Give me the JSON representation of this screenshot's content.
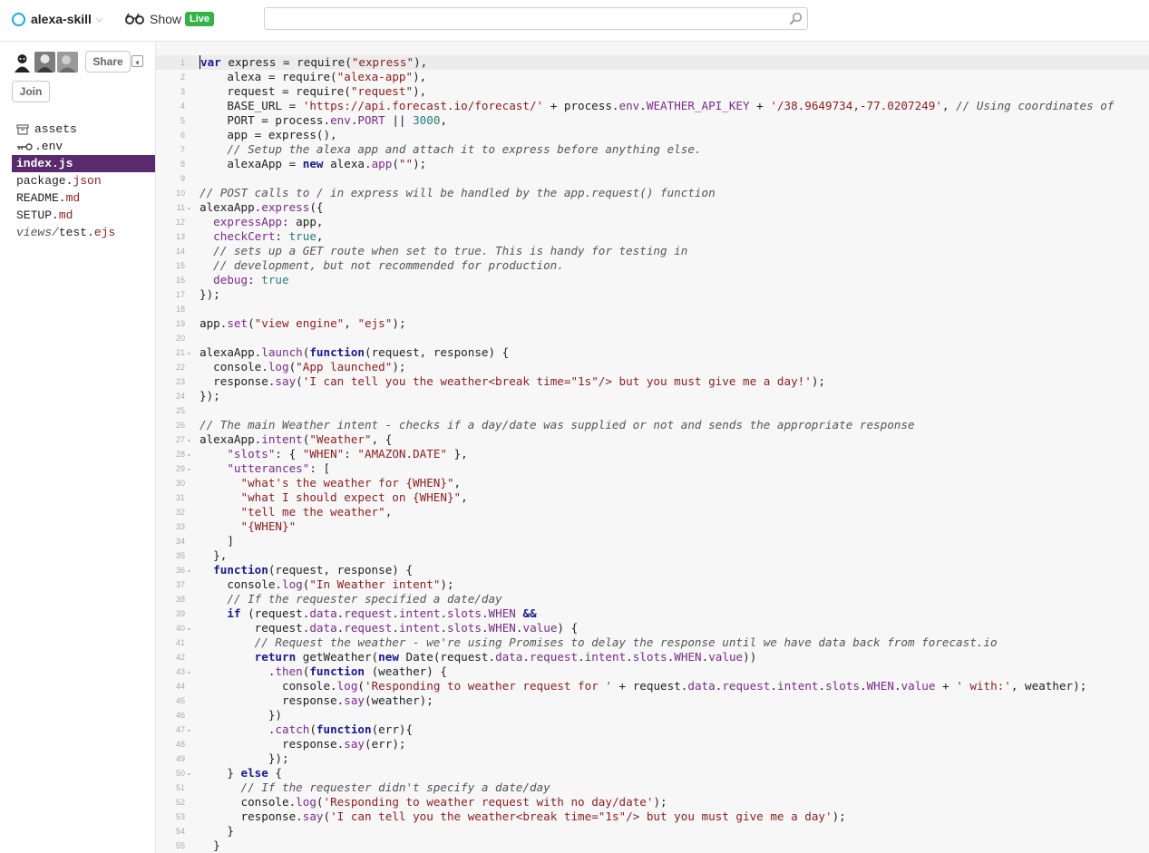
{
  "header": {
    "project_name": "alexa-skill",
    "show_label": "Show",
    "live_badge": "Live",
    "search_value": ""
  },
  "sidebar": {
    "share_label": "Share",
    "join_label": "Join",
    "files": [
      {
        "name": "assets",
        "ext": "",
        "icon": "archive-icon"
      },
      {
        "name": ".env",
        "ext": "",
        "icon": "key-icon"
      },
      {
        "name": "index.js",
        "ext": "",
        "icon": ""
      },
      {
        "name": "package.",
        "ext": "json",
        "icon": ""
      },
      {
        "name": "README.",
        "ext": "md",
        "icon": ""
      },
      {
        "name": "SETUP.",
        "ext": "md",
        "icon": ""
      },
      {
        "folder": "views/",
        "name": "test.",
        "ext": "ejs",
        "icon": ""
      }
    ]
  },
  "editor": {
    "active_file": "index.js",
    "current_line": 1,
    "lines": [
      [
        [
          "k",
          "var"
        ],
        [
          "t",
          " express = require("
        ],
        [
          "s",
          "\"express\""
        ],
        [
          "t",
          "),"
        ]
      ],
      [
        [
          "t",
          "    alexa = require("
        ],
        [
          "s",
          "\"alexa-app\""
        ],
        [
          "t",
          "),"
        ]
      ],
      [
        [
          "t",
          "    request = require("
        ],
        [
          "s",
          "\"request\""
        ],
        [
          "t",
          "),"
        ]
      ],
      [
        [
          "t",
          "    BASE_URL = "
        ],
        [
          "s",
          "'https://api.forecast.io/forecast/'"
        ],
        [
          "t",
          " + process."
        ],
        [
          "p",
          "env"
        ],
        [
          "t",
          "."
        ],
        [
          "p",
          "WEATHER_API_KEY"
        ],
        [
          "t",
          " + "
        ],
        [
          "s",
          "'/38.9649734,-77.0207249'"
        ],
        [
          "t",
          ", "
        ],
        [
          "c",
          "// Using coordinates of"
        ]
      ],
      [
        [
          "t",
          "    PORT = process."
        ],
        [
          "p",
          "env"
        ],
        [
          "t",
          "."
        ],
        [
          "p",
          "PORT"
        ],
        [
          "t",
          " || "
        ],
        [
          "n",
          "3000"
        ],
        [
          "t",
          ","
        ]
      ],
      [
        [
          "t",
          "    app = express(),"
        ]
      ],
      [
        [
          "c",
          "    // Setup the alexa app and attach it to express before anything else."
        ]
      ],
      [
        [
          "t",
          "    alexaApp = "
        ],
        [
          "k",
          "new"
        ],
        [
          "t",
          " alexa."
        ],
        [
          "p",
          "app"
        ],
        [
          "t",
          "("
        ],
        [
          "s",
          "\"\""
        ],
        [
          "t",
          ");"
        ]
      ],
      [],
      [
        [
          "c",
          "// POST calls to / in express will be handled by the app.request() function"
        ]
      ],
      [
        [
          "t",
          "alexaApp."
        ],
        [
          "p",
          "express"
        ],
        [
          "t",
          "({"
        ]
      ],
      [
        [
          "p",
          "  expressApp"
        ],
        [
          "t",
          ": app,"
        ]
      ],
      [
        [
          "p",
          "  checkCert"
        ],
        [
          "t",
          ": "
        ],
        [
          "n",
          "true"
        ],
        [
          "t",
          ","
        ]
      ],
      [
        [
          "c",
          "  // sets up a GET route when set to true. This is handy for testing in"
        ]
      ],
      [
        [
          "c",
          "  // development, but not recommended for production."
        ]
      ],
      [
        [
          "p",
          "  debug"
        ],
        [
          "t",
          ": "
        ],
        [
          "n",
          "true"
        ]
      ],
      [
        [
          "t",
          "});"
        ]
      ],
      [],
      [
        [
          "t",
          "app."
        ],
        [
          "p",
          "set"
        ],
        [
          "t",
          "("
        ],
        [
          "s",
          "\"view engine\""
        ],
        [
          "t",
          ", "
        ],
        [
          "s",
          "\"ejs\""
        ],
        [
          "t",
          ");"
        ]
      ],
      [],
      [
        [
          "t",
          "alexaApp."
        ],
        [
          "p",
          "launch"
        ],
        [
          "t",
          "("
        ],
        [
          "k",
          "function"
        ],
        [
          "t",
          "(request, response) {"
        ]
      ],
      [
        [
          "t",
          "  console."
        ],
        [
          "p",
          "log"
        ],
        [
          "t",
          "("
        ],
        [
          "s",
          "\"App launched\""
        ],
        [
          "t",
          ");"
        ]
      ],
      [
        [
          "t",
          "  response."
        ],
        [
          "p",
          "say"
        ],
        [
          "t",
          "("
        ],
        [
          "s",
          "'I can tell you the weather<break time=\"1s\"/> but you must give me a day!'"
        ],
        [
          "t",
          ");"
        ]
      ],
      [
        [
          "t",
          "});"
        ]
      ],
      [],
      [
        [
          "c",
          "// The main Weather intent - checks if a day/date was supplied or not and sends the appropriate response"
        ]
      ],
      [
        [
          "t",
          "alexaApp."
        ],
        [
          "p",
          "intent"
        ],
        [
          "t",
          "("
        ],
        [
          "s",
          "\"Weather\""
        ],
        [
          "t",
          ", {"
        ]
      ],
      [
        [
          "p",
          "    \"slots\""
        ],
        [
          "t",
          ": { "
        ],
        [
          "s",
          "\"WHEN\""
        ],
        [
          "t",
          ": "
        ],
        [
          "s",
          "\"AMAZON.DATE\""
        ],
        [
          "t",
          " },"
        ]
      ],
      [
        [
          "p",
          "    \"utterances\""
        ],
        [
          "t",
          ": ["
        ]
      ],
      [
        [
          "s",
          "      \"what's the weather for {WHEN}\""
        ],
        [
          "t",
          ","
        ]
      ],
      [
        [
          "s",
          "      \"what I should expect on {WHEN}\""
        ],
        [
          "t",
          ","
        ]
      ],
      [
        [
          "s",
          "      \"tell me the weather\""
        ],
        [
          "t",
          ","
        ]
      ],
      [
        [
          "s",
          "      \"{WHEN}\""
        ]
      ],
      [
        [
          "t",
          "    ]"
        ]
      ],
      [
        [
          "t",
          "  },"
        ]
      ],
      [
        [
          "k",
          "  function"
        ],
        [
          "t",
          "(request, response) {"
        ]
      ],
      [
        [
          "t",
          "    console."
        ],
        [
          "p",
          "log"
        ],
        [
          "t",
          "("
        ],
        [
          "s",
          "\"In Weather intent\""
        ],
        [
          "t",
          ");"
        ]
      ],
      [
        [
          "c",
          "    // If the requester specified a date/day"
        ]
      ],
      [
        [
          "k",
          "    if"
        ],
        [
          "t",
          " (request."
        ],
        [
          "p",
          "data"
        ],
        [
          "t",
          "."
        ],
        [
          "p",
          "request"
        ],
        [
          "t",
          "."
        ],
        [
          "p",
          "intent"
        ],
        [
          "t",
          "."
        ],
        [
          "p",
          "slots"
        ],
        [
          "t",
          "."
        ],
        [
          "p",
          "WHEN"
        ],
        [
          "t",
          " "
        ],
        [
          "k",
          "&&"
        ]
      ],
      [
        [
          "t",
          "        request."
        ],
        [
          "p",
          "data"
        ],
        [
          "t",
          "."
        ],
        [
          "p",
          "request"
        ],
        [
          "t",
          "."
        ],
        [
          "p",
          "intent"
        ],
        [
          "t",
          "."
        ],
        [
          "p",
          "slots"
        ],
        [
          "t",
          "."
        ],
        [
          "p",
          "WHEN"
        ],
        [
          "t",
          "."
        ],
        [
          "p",
          "value"
        ],
        [
          "t",
          ") {"
        ]
      ],
      [
        [
          "c",
          "        // Request the weather - we're using Promises to delay the response until we have data back from forecast.io"
        ]
      ],
      [
        [
          "k",
          "        return"
        ],
        [
          "t",
          " getWeather("
        ],
        [
          "k",
          "new"
        ],
        [
          "t",
          " Date(request."
        ],
        [
          "p",
          "data"
        ],
        [
          "t",
          "."
        ],
        [
          "p",
          "request"
        ],
        [
          "t",
          "."
        ],
        [
          "p",
          "intent"
        ],
        [
          "t",
          "."
        ],
        [
          "p",
          "slots"
        ],
        [
          "t",
          "."
        ],
        [
          "p",
          "WHEN"
        ],
        [
          "t",
          "."
        ],
        [
          "p",
          "value"
        ],
        [
          "t",
          "))"
        ]
      ],
      [
        [
          "t",
          "          ."
        ],
        [
          "p",
          "then"
        ],
        [
          "t",
          "("
        ],
        [
          "k",
          "function"
        ],
        [
          "t",
          " (weather) {"
        ]
      ],
      [
        [
          "t",
          "            console."
        ],
        [
          "p",
          "log"
        ],
        [
          "t",
          "("
        ],
        [
          "s",
          "'Responding to weather request for '"
        ],
        [
          "t",
          " + request."
        ],
        [
          "p",
          "data"
        ],
        [
          "t",
          "."
        ],
        [
          "p",
          "request"
        ],
        [
          "t",
          "."
        ],
        [
          "p",
          "intent"
        ],
        [
          "t",
          "."
        ],
        [
          "p",
          "slots"
        ],
        [
          "t",
          "."
        ],
        [
          "p",
          "WHEN"
        ],
        [
          "t",
          "."
        ],
        [
          "p",
          "value"
        ],
        [
          "t",
          " + "
        ],
        [
          "s",
          "' with:'"
        ],
        [
          "t",
          ", weather);"
        ]
      ],
      [
        [
          "t",
          "            response."
        ],
        [
          "p",
          "say"
        ],
        [
          "t",
          "(weather);"
        ]
      ],
      [
        [
          "t",
          "          })"
        ]
      ],
      [
        [
          "t",
          "          ."
        ],
        [
          "p",
          "catch"
        ],
        [
          "t",
          "("
        ],
        [
          "k",
          "function"
        ],
        [
          "t",
          "(err){"
        ]
      ],
      [
        [
          "t",
          "            response."
        ],
        [
          "p",
          "say"
        ],
        [
          "t",
          "(err);"
        ]
      ],
      [
        [
          "t",
          "          });"
        ]
      ],
      [
        [
          "t",
          "    } "
        ],
        [
          "k",
          "else"
        ],
        [
          "t",
          " {"
        ]
      ],
      [
        [
          "c",
          "      // If the requester didn't specify a date/day"
        ]
      ],
      [
        [
          "t",
          "      console."
        ],
        [
          "p",
          "log"
        ],
        [
          "t",
          "("
        ],
        [
          "s",
          "'Responding to weather request with no day/date'"
        ],
        [
          "t",
          ");"
        ]
      ],
      [
        [
          "t",
          "      response."
        ],
        [
          "p",
          "say"
        ],
        [
          "t",
          "("
        ],
        [
          "s",
          "'I can tell you the weather<break time=\"1s\"/> but you must give me a day'"
        ],
        [
          "t",
          ");"
        ]
      ],
      [
        [
          "t",
          "    }"
        ]
      ],
      [
        [
          "t",
          "  }"
        ]
      ]
    ],
    "fold_lines": [
      11,
      21,
      27,
      28,
      29,
      36,
      40,
      43,
      47,
      50
    ]
  },
  "colors": {
    "active_file_bg": "#5a2a6c",
    "live_badge_bg": "#36b24a",
    "keyword": "#1a1a8e",
    "string": "#8b1d1d",
    "comment": "#555555",
    "property": "#7a2a8a",
    "number": "#2a7a7a"
  }
}
